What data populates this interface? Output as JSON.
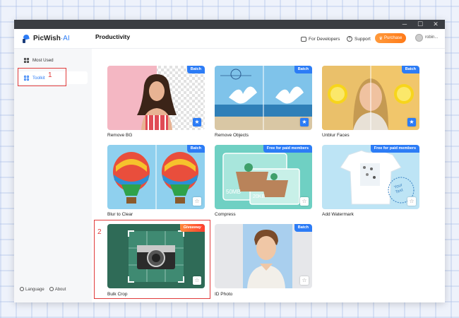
{
  "app": {
    "name": "PicWish",
    "name_suffix": "·AI",
    "user": "robin..."
  },
  "header": {
    "for_developers": "For Developers",
    "support": "Support",
    "purchase": "Purchase"
  },
  "sidebar": {
    "items": [
      {
        "label": "Most Used",
        "icon": "grid-icon"
      },
      {
        "label": "Toolkit",
        "icon": "grid-icon"
      }
    ],
    "bottom": {
      "language": "Language",
      "about": "About"
    }
  },
  "main": {
    "section_title": "Productivity",
    "cards": [
      {
        "label": "Remove BG",
        "badge": "Batch",
        "favorite": true
      },
      {
        "label": "Remove Objects",
        "badge": "Batch",
        "favorite": true
      },
      {
        "label": "Unblur Faces",
        "badge": "Batch",
        "favorite": true
      },
      {
        "label": "Blur to Clear",
        "badge": "Batch",
        "favorite": false
      },
      {
        "label": "Compress",
        "badge": "Free for paid members",
        "favorite": false,
        "size_before": "50MB",
        "size_after": "20KB"
      },
      {
        "label": "Add Watermark",
        "badge": "Free for paid members",
        "favorite": false,
        "watermark_text_1": "Your",
        "watermark_text_2": "Text"
      },
      {
        "label": "Bulk Crop",
        "badge": "Giveaway",
        "favorite": false
      },
      {
        "label": "ID Photo",
        "badge": "Batch",
        "favorite": false
      }
    ]
  },
  "annotations": {
    "one": "1",
    "two": "2"
  },
  "colors": {
    "accent": "#2c7cf6",
    "annotation": "#e13b3b",
    "purchase": "#ff8a2a"
  }
}
